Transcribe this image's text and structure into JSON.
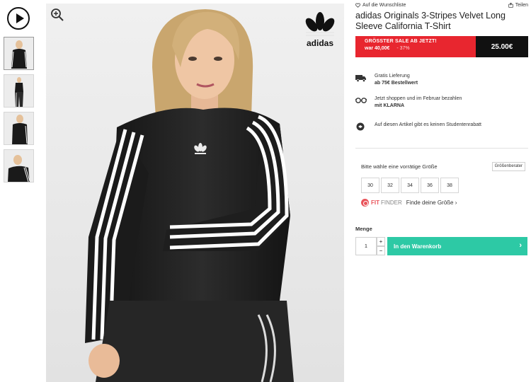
{
  "top_links": {
    "wishlist": "Auf die Wunschliste",
    "share": "Teilen"
  },
  "product": {
    "title": "adidas Originals 3-Stripes Velvet Long Sleeve California T-Shirt",
    "brand_logo_text": "adidas"
  },
  "price": {
    "sale_headline": "GRÖSSTER SALE AB JETZT!",
    "was_label": "war 40,00€",
    "discount": "- 37%",
    "current": "25.00€"
  },
  "usps": [
    {
      "line1": "Gratis Lieferung",
      "line2": "ab 75€ Bestellwert",
      "icon": "truck-icon"
    },
    {
      "line1": "Jetzt shoppen und im Februar bezahlen",
      "line2": "mit KLARNA",
      "icon": "klarna-glasses-icon"
    },
    {
      "line1": "Auf diesen Artikel gibt es keinen Studentenrabatt",
      "line2": "",
      "icon": "student-info-icon"
    }
  ],
  "sizes": {
    "heading": "Bitte wähle eine vorrätige Größe",
    "guide_button": "Größenberater",
    "options": [
      "30",
      "32",
      "34",
      "36",
      "38"
    ]
  },
  "fit_finder": {
    "fit": "FIT",
    "finder": "FINDER",
    "link": "Finde deine Größe ›"
  },
  "quantity": {
    "label": "Menge",
    "value": "1",
    "plus": "+",
    "minus": "−"
  },
  "cart": {
    "label": "In den Warenkorb",
    "chevron": "›"
  },
  "colors": {
    "sale_red": "#e8262f",
    "cart_teal": "#2dc9a5",
    "fitfinder_red": "#e9545b"
  }
}
